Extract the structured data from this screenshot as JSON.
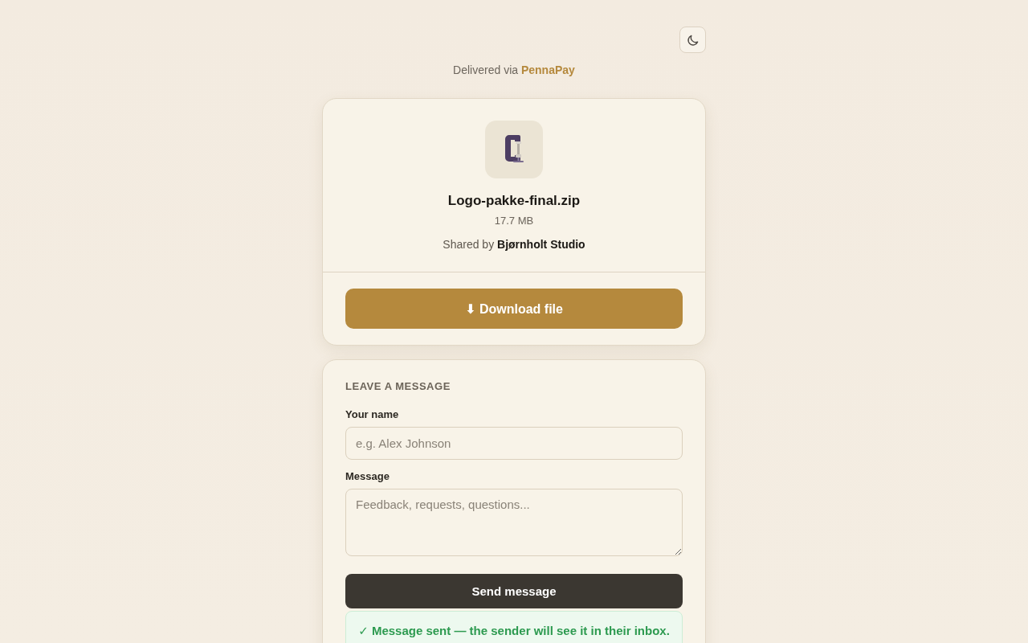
{
  "delivered_via": {
    "text": "Delivered via",
    "brand": "PennaPay"
  },
  "file": {
    "name": "Logo-pakke-final.zip",
    "size": "17.7 MB",
    "shared_by": "Shared by **Bjørnholt Studio**"
  },
  "download_button": "⬇ Download file",
  "message_form": {
    "heading": "LEAVE A MESSAGE",
    "fields": [
      {
        "kind": "input",
        "label": "Your name",
        "placeholder": "e.g. Alex Johnson"
      },
      {
        "kind": "textarea",
        "label": "Message",
        "placeholder": "Feedback, requests, questions..."
      }
    ],
    "submit": "Send message",
    "notice": "✓ Message sent — the sender will see it in their inbox."
  }
}
